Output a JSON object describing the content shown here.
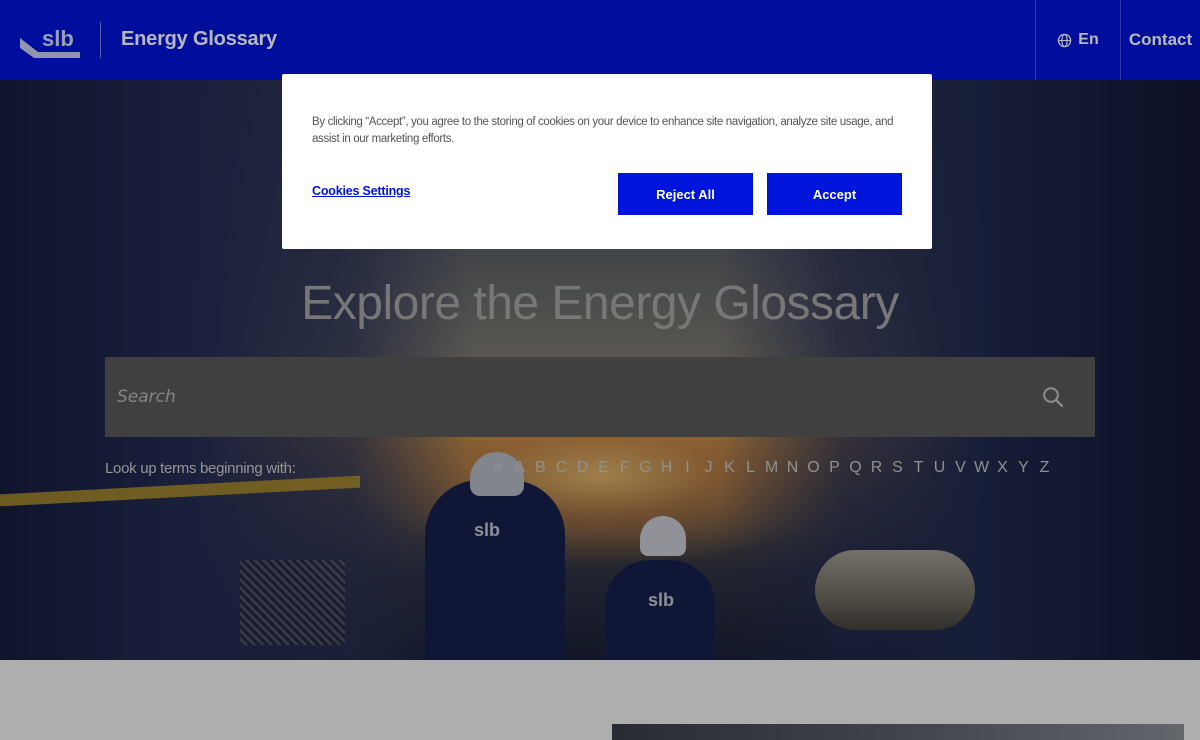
{
  "header": {
    "logo_text": "slb",
    "title": "Energy Glossary",
    "language": "En",
    "contact": "Contact"
  },
  "hero": {
    "title": "Explore the Energy Glossary",
    "search_placeholder": "Search",
    "lookup_label": "Look up terms beginning with:",
    "letters": [
      "#",
      "A",
      "B",
      "C",
      "D",
      "E",
      "F",
      "G",
      "H",
      "I",
      "J",
      "K",
      "L",
      "M",
      "N",
      "O",
      "P",
      "Q",
      "R",
      "S",
      "T",
      "U",
      "V",
      "W",
      "X",
      "Y",
      "Z"
    ]
  },
  "cookie_banner": {
    "message": "By clicking “Accept”, you agree to the storing of cookies on your device to enhance site navigation, analyze site usage, and assist in our marketing efforts.",
    "settings_link": "Cookies Settings",
    "reject_label": "Reject All",
    "accept_label": "Accept"
  },
  "colors": {
    "brand_blue": "#0014dc",
    "search_bg": "#595959"
  }
}
